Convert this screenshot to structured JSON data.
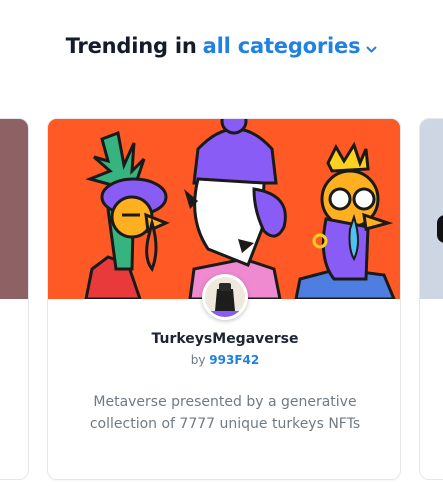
{
  "heading": {
    "prefix": "Trending in",
    "category": "all categories",
    "chevron_icon": "chevron-down-icon"
  },
  "colors": {
    "accent": "#2081e2",
    "banner": "#ff5a26",
    "left_card_banner": "#8e6164",
    "right_card_banner": "#cfd6e3"
  },
  "featured_card": {
    "name": "TurkeysMegaverse",
    "by_label": "by",
    "creator": "993F42",
    "description": "Metaverse presented by a generative collection of 7777 unique turkeys NFTs"
  }
}
